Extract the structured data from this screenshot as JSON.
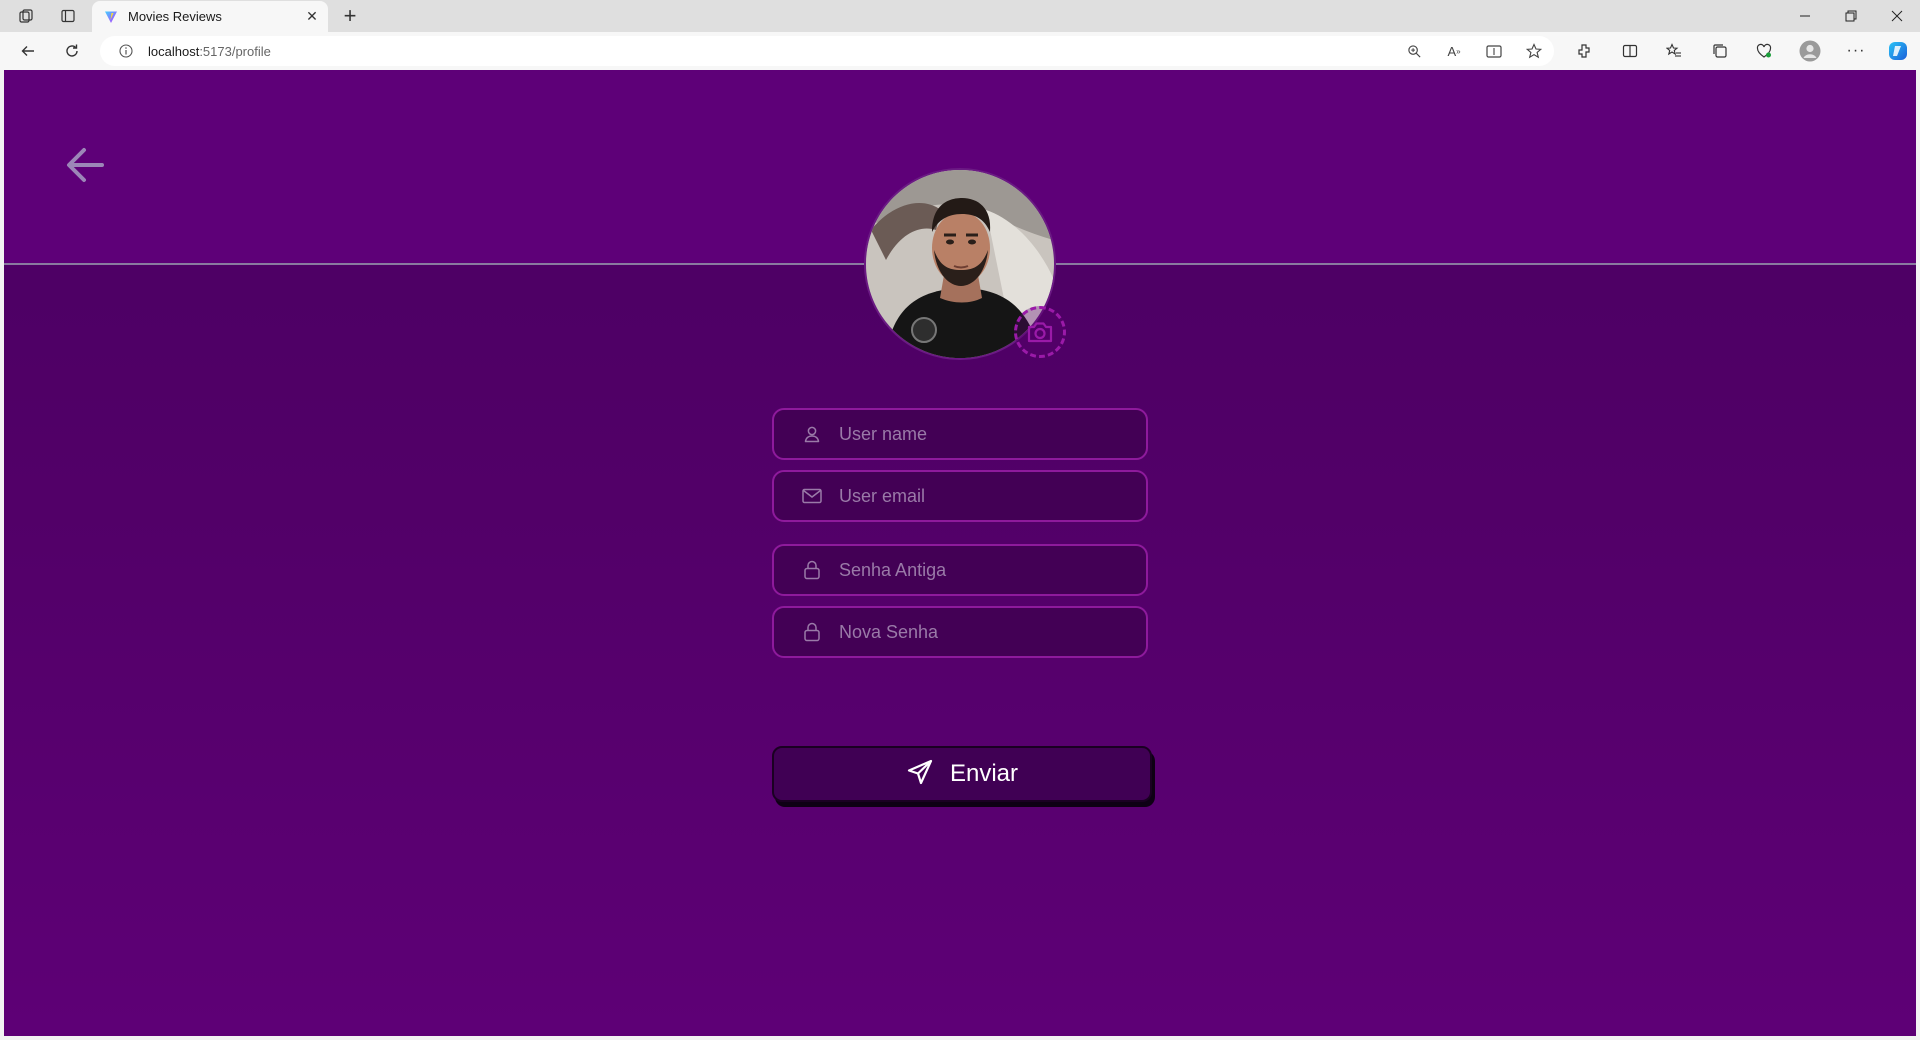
{
  "browser": {
    "tab_title": "Movies Reviews",
    "url_host": "localhost",
    "url_rest": ":5173/profile"
  },
  "page": {
    "form": {
      "username_placeholder": "User name",
      "email_placeholder": "User email",
      "old_password_placeholder": "Senha Antiga",
      "new_password_placeholder": "Nova Senha",
      "submit_label": "Enviar"
    }
  },
  "colors": {
    "header_bg": "#5e0078",
    "page_bg": "#520068",
    "field_border": "#8e1a9c",
    "button_bg": "#400054"
  }
}
